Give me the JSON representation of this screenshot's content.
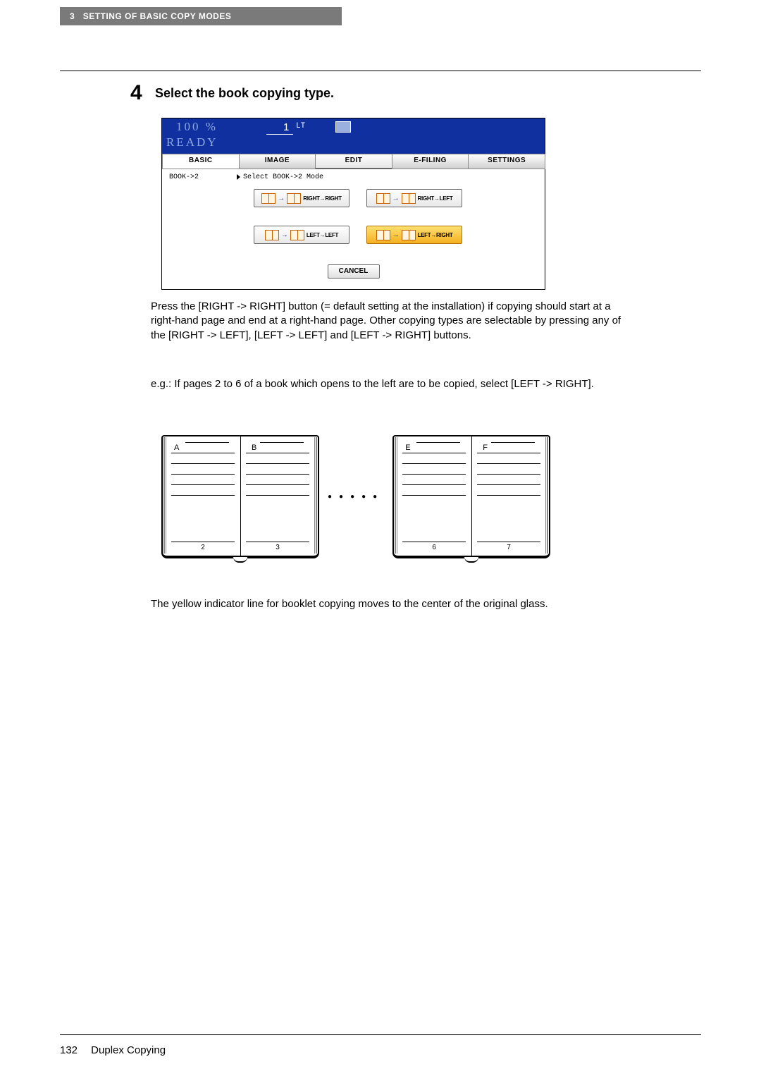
{
  "header": {
    "chapter_num": "3",
    "chapter_title": "SETTING OF BASIC COPY MODES"
  },
  "step": {
    "number": "4",
    "title": "Select the book copying type."
  },
  "screen": {
    "zoom": "100  %",
    "status": "READY",
    "quantity": "1",
    "paper": "LT",
    "tabs": {
      "basic": "BASIC",
      "image": "IMAGE",
      "edit": "EDIT",
      "efiling": "E-FILING",
      "settings": "SETTINGS"
    },
    "side_label": "BOOK->2",
    "subtitle": "Select BOOK->2 Mode",
    "modes": {
      "rr": "RIGHT→RIGHT",
      "rl": "RIGHT→LEFT",
      "ll": "LEFT→LEFT",
      "lr": "LEFT→RIGHT"
    },
    "cancel": "CANCEL"
  },
  "text": {
    "p1": "Press the [RIGHT -> RIGHT] button (= default setting at the installation) if copying should start at a right-hand page and end at a right-hand page. Other copying types are selectable by pressing any of the [RIGHT -> LEFT], [LEFT -> LEFT] and [LEFT -> RIGHT] buttons.",
    "p2": "e.g.: If pages 2 to 6 of a book which opens to the left are to be copied, select [LEFT -> RIGHT].",
    "p3": "The yellow indicator line for booklet copying moves to the center of the original glass."
  },
  "illus": {
    "book1": {
      "letter_left": "A",
      "letter_right": "B",
      "num_left": "2",
      "num_right": "3"
    },
    "book2": {
      "letter_left": "E",
      "letter_right": "F",
      "num_left": "6",
      "num_right": "7"
    }
  },
  "footer": {
    "page_number": "132",
    "section": "Duplex Copying"
  }
}
